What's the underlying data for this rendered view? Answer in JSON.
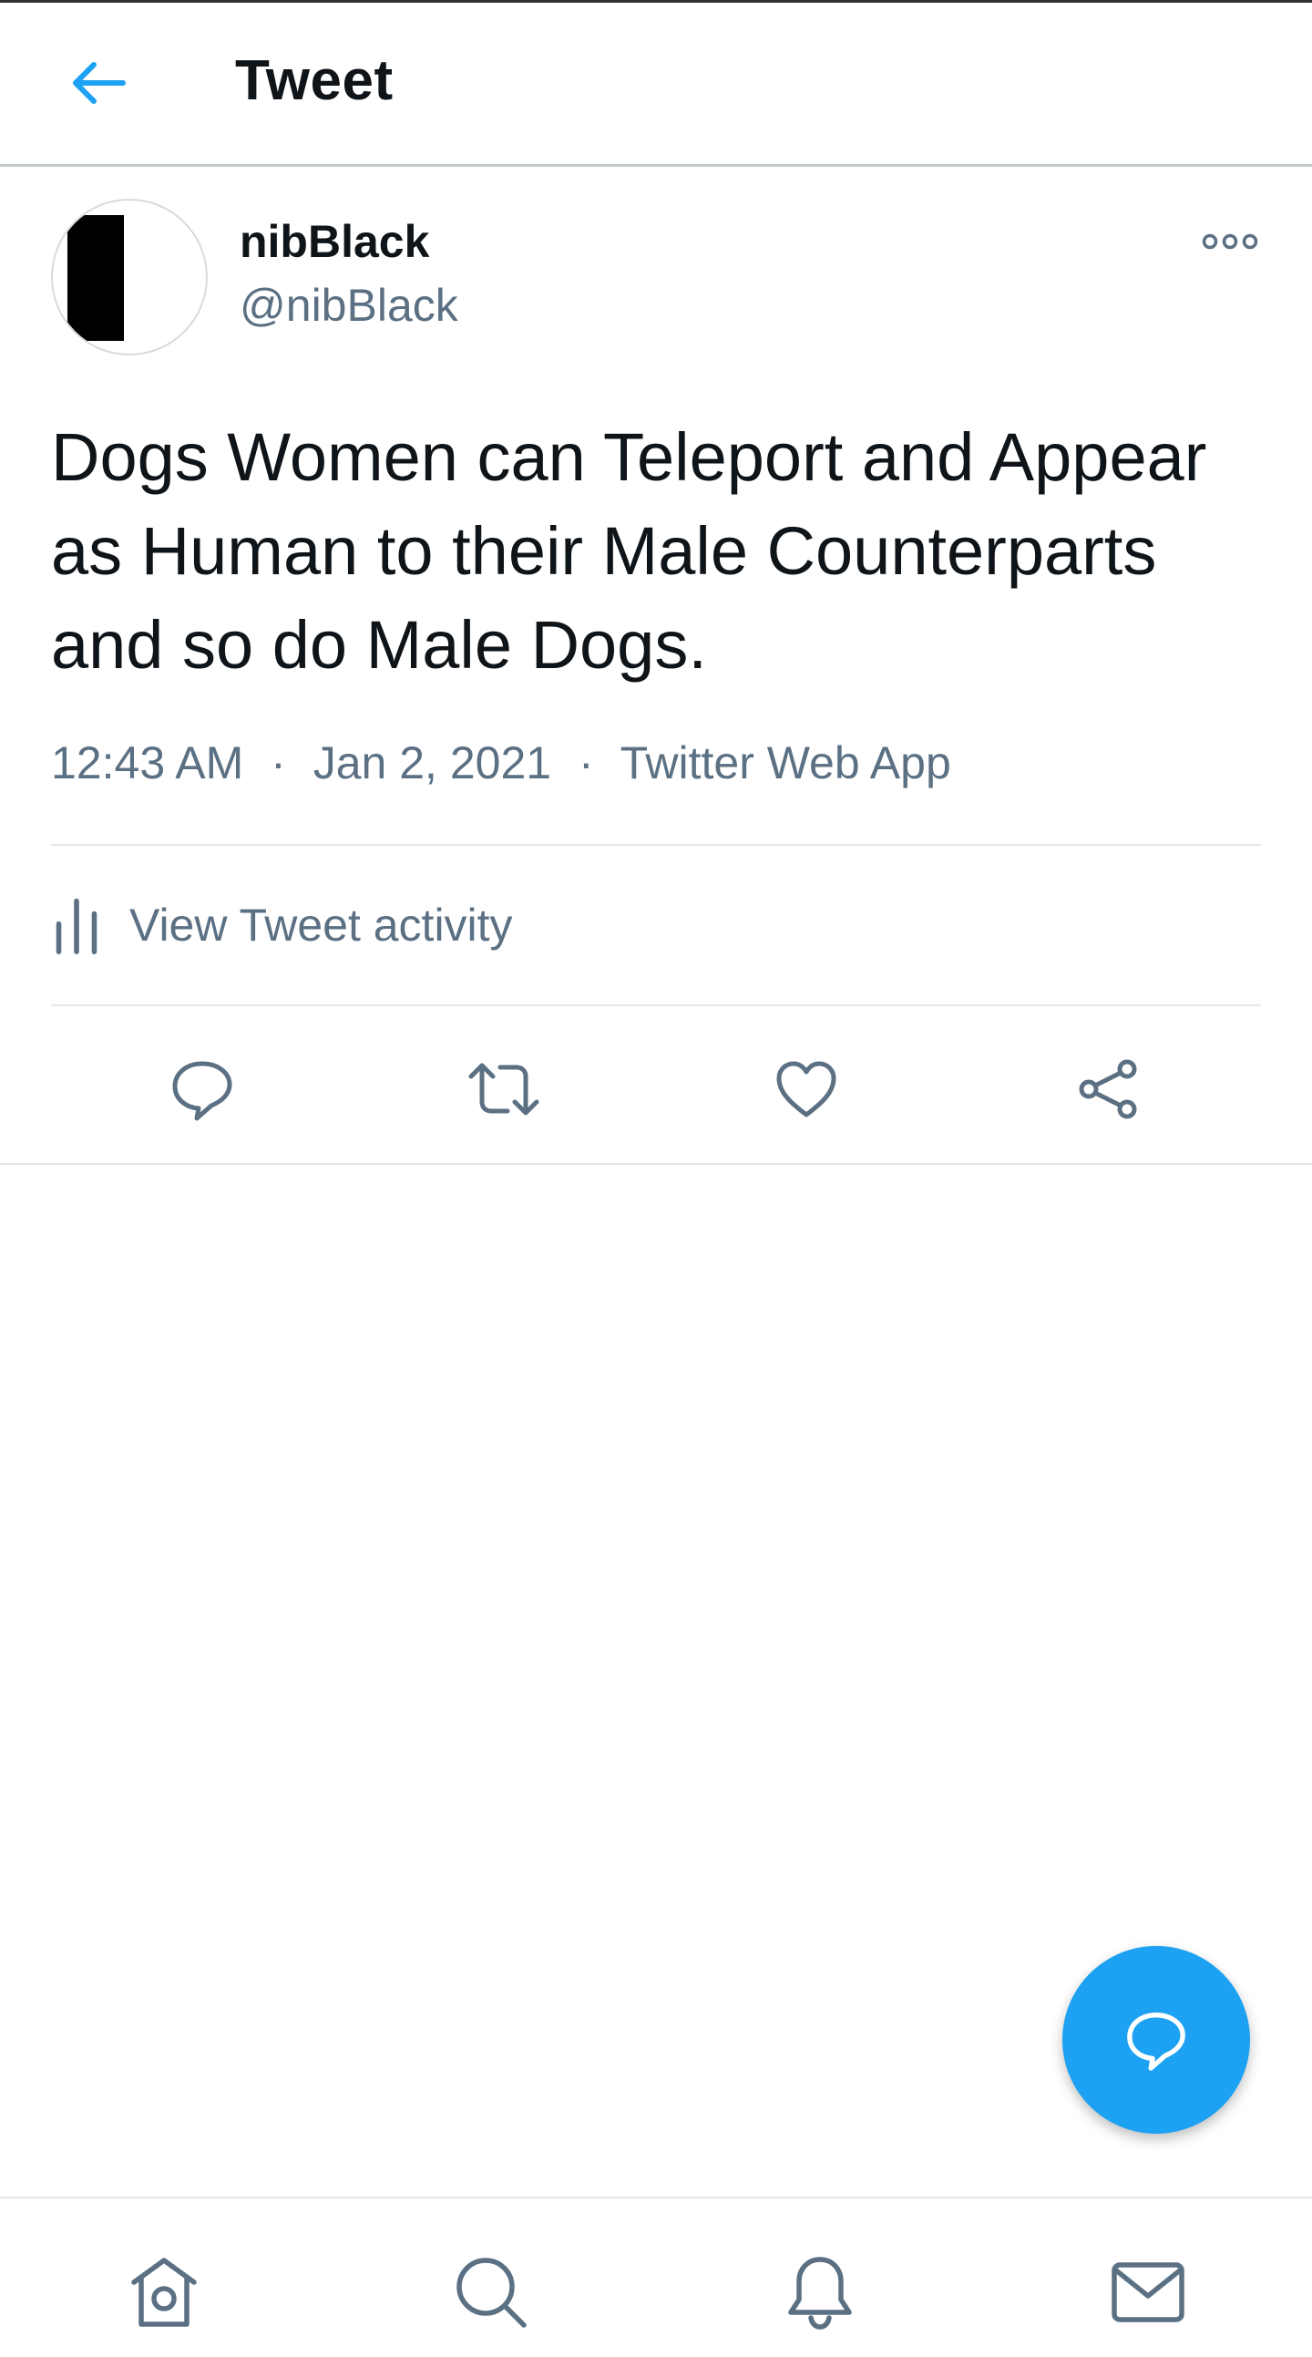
{
  "header": {
    "title": "Tweet",
    "back_icon": "arrow-left-icon"
  },
  "tweet": {
    "author_name": "nibBlack",
    "author_handle": "@nibBlack",
    "text": "Dogs Women can Teleport and Appear as Human to their Male Counterparts and so do Male Dogs.",
    "time": "12:43 AM",
    "date": "Jan 2, 2021",
    "source": "Twitter Web App",
    "separator": "·",
    "activity_label": "View Tweet activity"
  },
  "actions": [
    {
      "name": "reply",
      "icon": "reply-icon"
    },
    {
      "name": "retweet",
      "icon": "retweet-icon"
    },
    {
      "name": "like",
      "icon": "heart-icon"
    },
    {
      "name": "share",
      "icon": "share-icon"
    }
  ],
  "bottom_nav": [
    {
      "name": "home",
      "icon": "home-icon"
    },
    {
      "name": "search",
      "icon": "search-icon"
    },
    {
      "name": "notifications",
      "icon": "bell-icon"
    },
    {
      "name": "messages",
      "icon": "mail-icon"
    }
  ],
  "colors": {
    "accent": "#1da1f2",
    "text_primary": "#0f1419",
    "text_secondary": "#5b7083",
    "divider": "#e1e6ea"
  }
}
